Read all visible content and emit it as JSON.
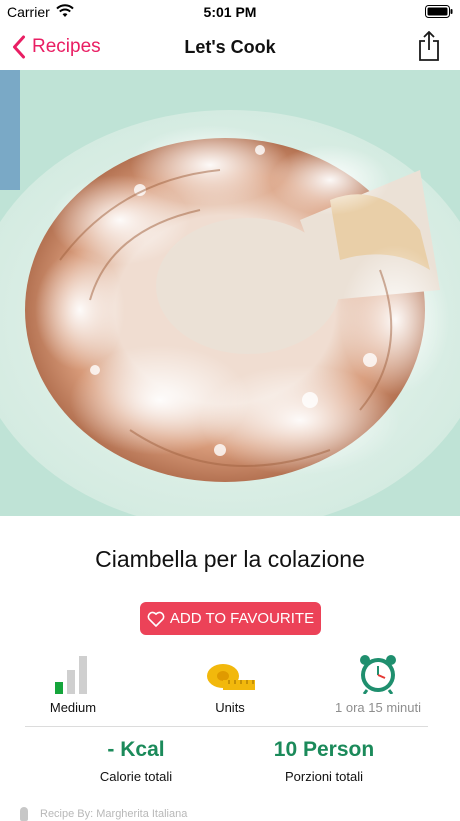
{
  "status_bar": {
    "carrier": "Carrier",
    "time": "5:01 PM",
    "icons": [
      "wifi-icon",
      "battery-icon"
    ]
  },
  "nav": {
    "back_label": "Recipes",
    "title": "Let's Cook",
    "accent_color": "#e91e63",
    "icons": [
      "chevron-left-icon",
      "share-icon"
    ]
  },
  "hero": {
    "image_subject": "ring-shaped cake dusted with powdered sugar"
  },
  "recipe": {
    "title": "Ciambella per la colazione",
    "favourite_label": "ADD TO FAVOURITE",
    "favourite_color": "#ec4258"
  },
  "stats": [
    {
      "label": "Medium",
      "icon": "difficulty-bars-icon",
      "level": 1
    },
    {
      "label": "Units",
      "icon": "measuring-tape-icon"
    },
    {
      "label": "1 ora 15 minuti",
      "icon": "alarm-clock-icon"
    }
  ],
  "metrics": [
    {
      "value": "- Kcal",
      "label": "Calorie totali"
    },
    {
      "value": "10 Person",
      "label": "Porzioni totali"
    }
  ],
  "metric_color": "#1b8a5a",
  "footer_peek": "Recipe By: Margherita Italiana"
}
